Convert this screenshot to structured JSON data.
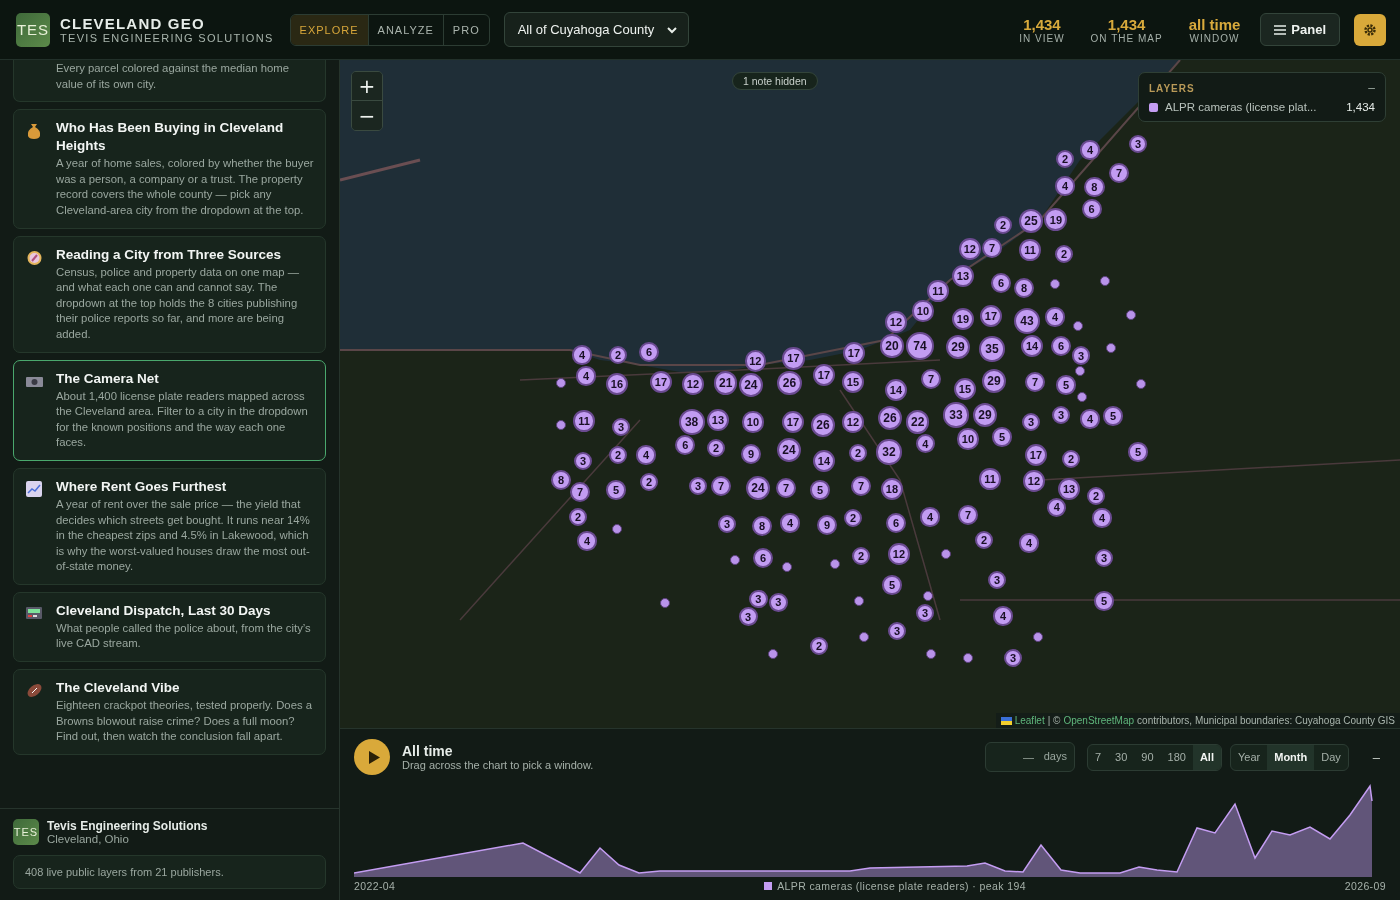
{
  "header": {
    "logo_text": "TES",
    "title": "CLEVELAND GEO",
    "subtitle": "TEVIS ENGINEERING SOLUTIONS",
    "tabs": [
      {
        "label": "EXPLORE",
        "selected": true
      },
      {
        "label": "ANALYZE",
        "selected": false
      },
      {
        "label": "PRO",
        "selected": false
      }
    ],
    "area_select": {
      "value": "All of Cuyahoga County"
    },
    "stats": [
      {
        "value": "1,434",
        "label": "IN VIEW"
      },
      {
        "value": "1,434",
        "label": "ON THE MAP"
      },
      {
        "value": "all time",
        "label": "WINDOW"
      }
    ],
    "panel_button": {
      "label": "Panel"
    }
  },
  "sidebar": {
    "stories": [
      {
        "text": "Every parcel colored against the median home value of its own city.",
        "selected": false
      },
      {
        "title": "Who Has Been Buying in Cleveland Heights",
        "text": "A year of home sales, colored by whether the buyer was a person, a company or a trust. The property record covers the whole county — pick any Cleveland-area city from the dropdown at the top.",
        "selected": false
      },
      {
        "title": "Reading a City from Three Sources",
        "text": "Census, police and property data on one map — and what each one can and cannot say. The dropdown at the top holds the 8 cities publishing their police reports so far, and more are being added.",
        "selected": false
      },
      {
        "title": "The Camera Net",
        "text": "About 1,400 license plate readers mapped across the Cleveland area. Filter to a city in the dropdown for the known positions and the way each one faces.",
        "selected": true
      },
      {
        "title": "Where Rent Goes Furthest",
        "text": "A year of rent over the sale price — the yield that decides which streets get bought. It runs near 14% in the cheapest zips and 4.5% in Lakewood, which is why the worst-valued houses draw the most out-of-state money.",
        "selected": false
      },
      {
        "title": "Cleveland Dispatch, Last 30 Days",
        "text": "What people called the police about, from the city’s live CAD stream.",
        "selected": false
      },
      {
        "title": "The Cleveland Vibe",
        "text": "Eighteen crackpot theories, tested properly. Does a Browns blowout raise crime? Does a full moon? Find out, then watch the conclusion fall apart.",
        "selected": false
      }
    ],
    "footer": {
      "logo_text": "TES",
      "name": "Tevis Engineering Solutions",
      "place": "Cleveland, Ohio",
      "note": "408 live public layers from 21 publishers."
    }
  },
  "map": {
    "zoom_in": "+",
    "zoom_out": "−",
    "note": "1 note hidden",
    "layers": {
      "title": "LAYERS",
      "collapse": "–",
      "items": [
        {
          "name": "ALPR cameras (license plat...",
          "count": "1,434",
          "color": "#c49df2"
        }
      ]
    },
    "clusters": [
      "2",
      "4",
      "3",
      "4",
      "8",
      "7",
      "6",
      "2",
      "25",
      "19",
      "12",
      "7",
      "11",
      "2",
      "11",
      "13",
      "6",
      "8",
      "12",
      "10",
      "19",
      "17",
      "43",
      "4",
      "4",
      "2",
      "6",
      "12",
      "17",
      "17",
      "20",
      "74",
      "29",
      "35",
      "14",
      "6",
      "3",
      "4",
      "16",
      "17",
      "12",
      "21",
      "24",
      "26",
      "17",
      "15",
      "14",
      "7",
      "15",
      "29",
      "7",
      "5",
      "11",
      "3",
      "38",
      "13",
      "10",
      "17",
      "26",
      "12",
      "26",
      "22",
      "33",
      "29",
      "3",
      "3",
      "4",
      "5",
      "3",
      "2",
      "4",
      "6",
      "2",
      "9",
      "24",
      "14",
      "2",
      "32",
      "4",
      "10",
      "5",
      "17",
      "2",
      "5",
      "8",
      "7",
      "5",
      "2",
      "3",
      "7",
      "24",
      "7",
      "5",
      "7",
      "18",
      "11",
      "12",
      "13",
      "2",
      "2",
      "3",
      "8",
      "4",
      "9",
      "2",
      "6",
      "4",
      "7",
      "4",
      "4",
      "4",
      "6",
      "2",
      "12",
      "2",
      "4",
      "3",
      "5",
      "3",
      "3",
      "3",
      "3",
      "3",
      "4",
      "5",
      "2",
      "3",
      "3"
    ],
    "attribution": {
      "leaflet": "Leaflet",
      "osm_prefix": "| ©",
      "osm": "OpenStreetMap",
      "rest": "contributors, Municipal boundaries: Cuyahoga County GIS"
    }
  },
  "timeline": {
    "title": "All time",
    "hint": "Drag across the chart to pick a window.",
    "days_field": {
      "placeholder": "—",
      "unit": "days"
    },
    "ranges": [
      {
        "label": "7",
        "selected": false
      },
      {
        "label": "30",
        "selected": false
      },
      {
        "label": "90",
        "selected": false
      },
      {
        "label": "180",
        "selected": false
      },
      {
        "label": "All",
        "selected": true
      }
    ],
    "granularity": [
      {
        "label": "Year",
        "selected": false
      },
      {
        "label": "Month",
        "selected": true
      },
      {
        "label": "Day",
        "selected": false
      }
    ],
    "collapse": "–",
    "start": "2022-04",
    "end": "2026-09",
    "legend": {
      "label": "ALPR cameras (license plate readers) · peak 194",
      "color": "#c49df2"
    }
  }
}
